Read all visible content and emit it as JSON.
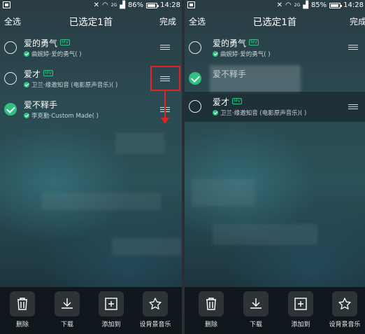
{
  "status_bar": {
    "left": {
      "battery_text": "86%",
      "time": "14:28",
      "network": "2G"
    },
    "right": {
      "battery_text": "85%",
      "time": "14:28",
      "network": "2G"
    }
  },
  "header": {
    "select_all_label": "全选",
    "left_title": "已选定1首",
    "right_title": "已选定1首",
    "done_label": "完成"
  },
  "left_list": [
    {
      "title": "爱的勇气",
      "subtitle": "曲婉婷·爱的勇气( )",
      "checked": false,
      "mv": true,
      "mv_label": "MV"
    },
    {
      "title": "爱才",
      "subtitle": "卫兰·缘邀知音 (电影原声音乐)( )",
      "checked": false,
      "mv": true,
      "mv_label": "MV"
    },
    {
      "title": "爱不释手",
      "subtitle": "李克勤·Custom Made( )",
      "checked": true,
      "mv": false
    }
  ],
  "right_list": [
    {
      "title": "爱的勇气",
      "subtitle": "曲婉婷·爱的勇气( )",
      "checked": false,
      "mv": true,
      "mv_label": "MV"
    },
    {
      "title": "爱不释手",
      "subtitle": "",
      "checked": true,
      "mv": false
    },
    {
      "title": "爱才",
      "subtitle": "卫兰·缘邀知音 (电影原声音乐)( )",
      "checked": false,
      "mv": true,
      "mv_label": "MV"
    }
  ],
  "actions": [
    {
      "label": "删除",
      "icon": "trash-icon"
    },
    {
      "label": "下载",
      "icon": "download-icon"
    },
    {
      "label": "添加到",
      "icon": "add-to-icon"
    },
    {
      "label": "设背景音乐",
      "icon": "star-icon"
    }
  ],
  "colors": {
    "accent_green": "#30c07f",
    "annotation_red": "#e52222"
  }
}
